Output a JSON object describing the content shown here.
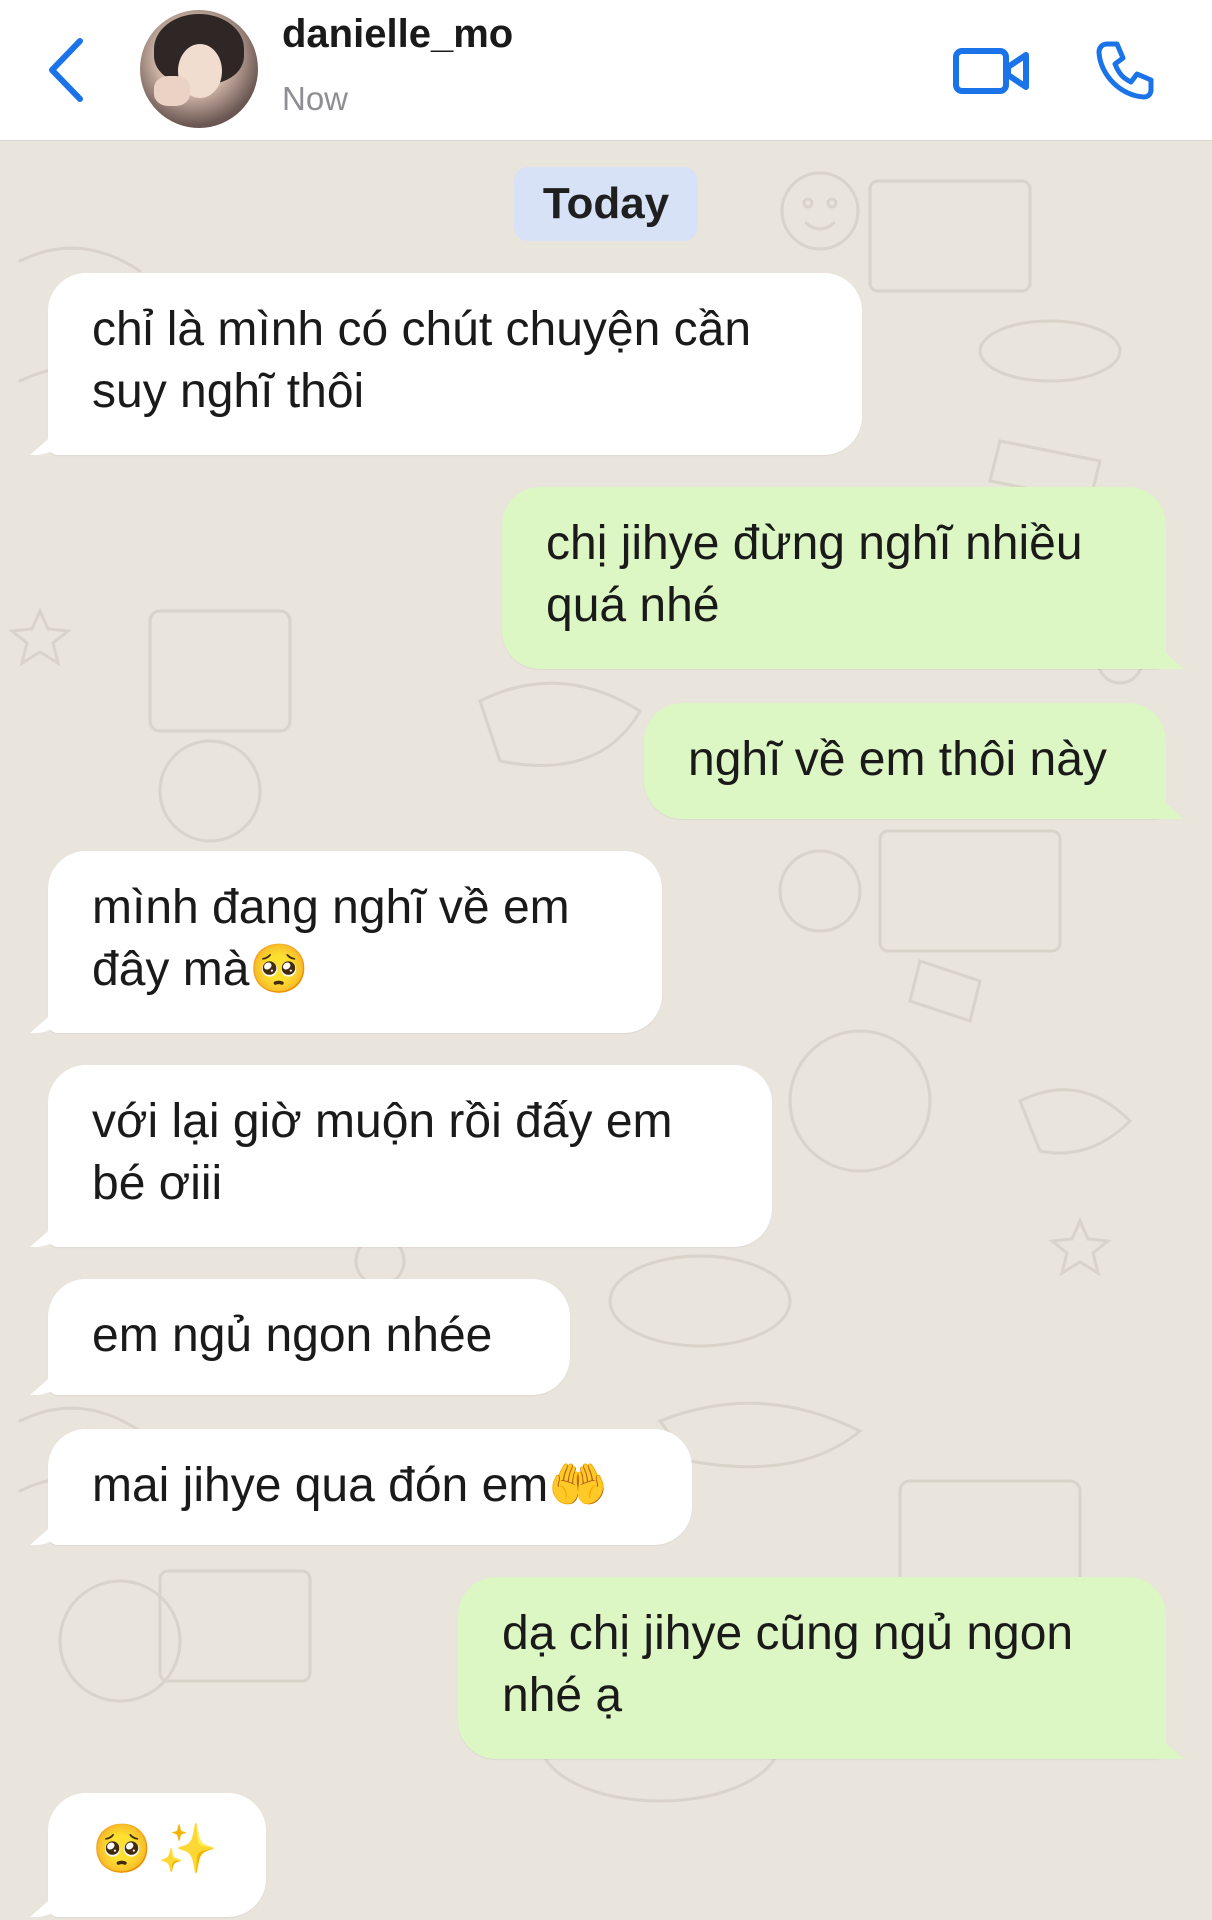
{
  "header": {
    "back_icon": "chevron-left-icon",
    "contact_name": "danielle_mo",
    "status": "Now",
    "video_icon": "video-camera-icon",
    "phone_icon": "phone-icon"
  },
  "colors": {
    "accent": "#1a73e8",
    "incoming_bubble": "#ffffff",
    "outgoing_bubble": "#dcf6c4",
    "date_chip": "#d7e2f6",
    "chat_background": "#e9e4dc"
  },
  "chat": {
    "date_separator": "Today",
    "messages": [
      {
        "direction": "incoming",
        "text": "chỉ là mình có chút chuyện cần suy nghĩ thôi"
      },
      {
        "direction": "outgoing",
        "text": "chị jihye đừng nghĩ nhiều quá nhé"
      },
      {
        "direction": "outgoing",
        "text": "nghĩ về em thôi này"
      },
      {
        "direction": "incoming",
        "text": "mình đang nghĩ về em đây mà🥺"
      },
      {
        "direction": "incoming",
        "text": "với lại giờ muộn rồi đấy em bé ơiii"
      },
      {
        "direction": "incoming",
        "text": "em ngủ ngon nhée"
      },
      {
        "direction": "incoming",
        "text": "mai jihye qua đón em🤲"
      },
      {
        "direction": "outgoing",
        "text": "dạ chị jihye cũng ngủ ngon nhé ạ"
      },
      {
        "direction": "incoming",
        "text": "🥺✨"
      }
    ]
  }
}
